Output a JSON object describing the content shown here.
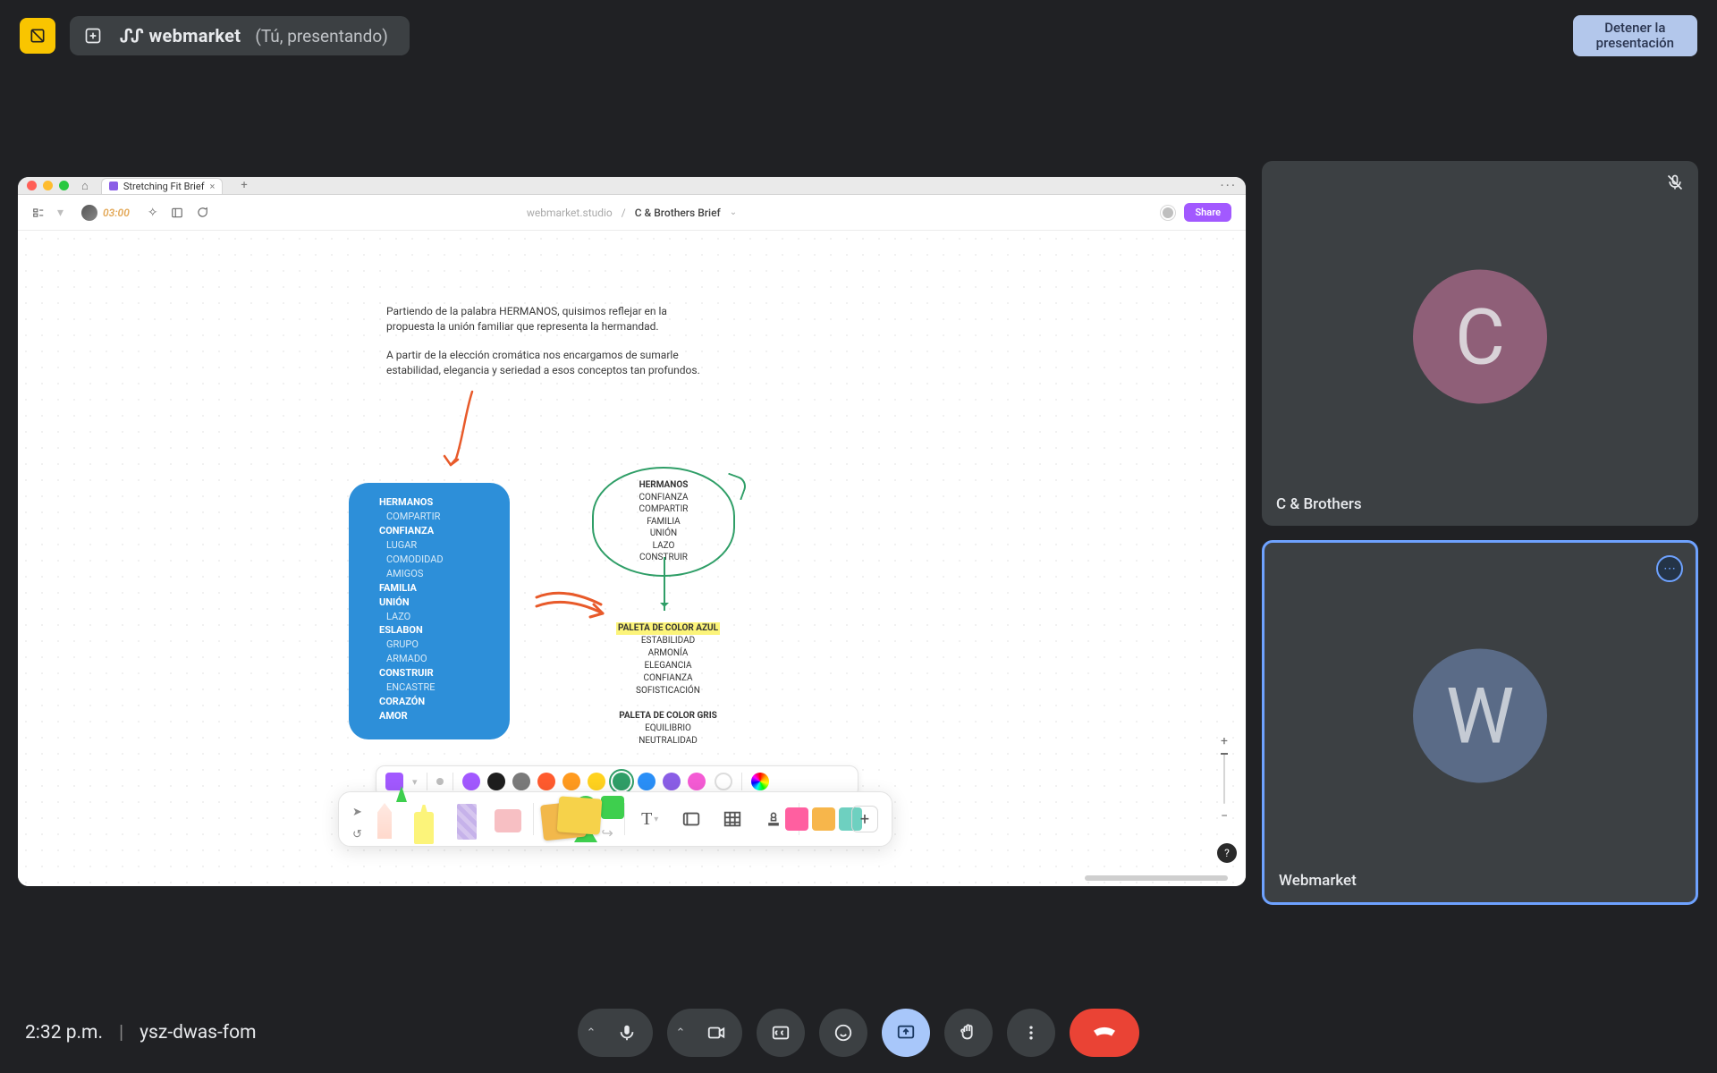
{
  "top_bar": {
    "brand": "webmarket",
    "presenting_label": "(Tú, presentando)",
    "stop_button": "Detener la\npresentación"
  },
  "mac": {
    "tab_title": "Stretching Fit Brief",
    "timer": "03:00",
    "crumb_workspace": "webmarket.studio",
    "crumb_doc": "C & Brothers Brief",
    "share": "Share"
  },
  "canvas": {
    "para1": "Partiendo de la palabra HERMANOS, quisimos reflejar en la propuesta la unión familiar que representa la hermandad.",
    "para2": "A partir de la elección cromática nos encargamos de sumarle estabilidad, elegancia y seriedad a esos conceptos tan profundos.",
    "blue_card": [
      "HERMANOS",
      "COMPARTIR",
      "CONFIANZA",
      "LUGAR",
      "COMODIDAD",
      "AMIGOS",
      "FAMILIA",
      "UNIÓN",
      "LAZO",
      "ESLABON",
      "GRUPO",
      "ARMADO",
      "CONSTRUIR",
      "ENCASTRE",
      "CORAZÓN",
      "AMOR"
    ],
    "blue_card_bold": [
      "HERMANOS",
      "CONFIANZA",
      "FAMILIA",
      "UNIÓN",
      "ESLABON",
      "CONSTRUIR",
      "CORAZÓN",
      "AMOR"
    ],
    "oval": [
      "HERMANOS",
      "CONFIANZA",
      "COMPARTIR",
      "FAMILIA",
      "UNIÓN",
      "LAZO",
      "CONSTRUIR"
    ],
    "palette_blue_title": "PALETA DE COLOR AZUL",
    "palette_blue_items": [
      "ESTABILIDAD",
      "ARMONÍA",
      "ELEGANCIA",
      "CONFIANZA",
      "SOFISTICACIÓN"
    ],
    "palette_gray_title": "PALETA DE COLOR GRIS",
    "palette_gray_items": [
      "EQUILIBRIO",
      "NEUTRALIDAD"
    ]
  },
  "zoom": {
    "plus": "+",
    "minus": "−",
    "help": "?"
  },
  "color_bar": {
    "colors": [
      "#a259ff",
      "#1e1e1e",
      "#7a7a7a",
      "#ff5b2e",
      "#ff9a1f",
      "#ffd21f",
      "#2f9e67",
      "#2a8ff7",
      "#8a5ee6",
      "#f45bd4"
    ]
  },
  "toolbar_icons": {
    "text": "T",
    "frame": "▭",
    "table": "▦",
    "stamp": "⌂",
    "plus": "+"
  },
  "participants": {
    "p1": {
      "initial": "C",
      "name": "C & Brothers"
    },
    "p2": {
      "initial": "W",
      "name": "Webmarket"
    }
  },
  "meet": {
    "time": "2:32 p.m.",
    "code": "ysz-dwas-fom"
  }
}
